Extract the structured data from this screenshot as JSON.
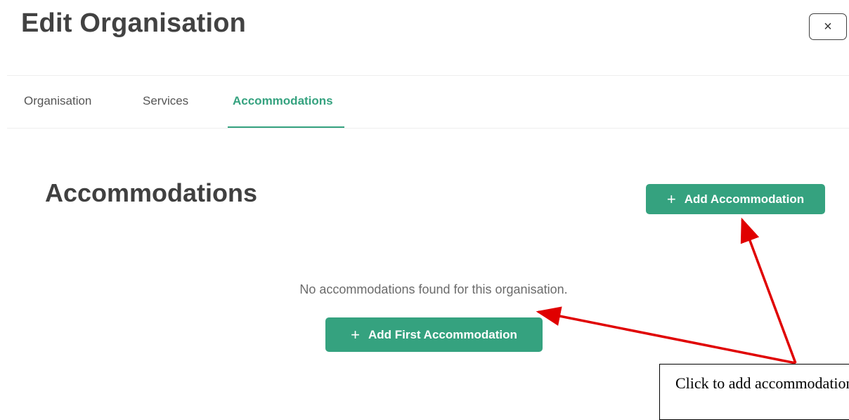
{
  "header": {
    "title": "Edit Organisation",
    "close_label": "×"
  },
  "tabs": [
    {
      "label": "Organisation",
      "active": false
    },
    {
      "label": "Services",
      "active": false
    },
    {
      "label": "Accommodations",
      "active": true
    }
  ],
  "section": {
    "title": "Accommodations",
    "add_button_label": "Add Accommodation",
    "plus_glyph": "+"
  },
  "empty_state": {
    "message": "No accommodations found for this organisation.",
    "button_label": "Add First Accommodation"
  },
  "annotation": {
    "text": "Click to add accommodation"
  },
  "colors": {
    "accent": "#35a27f",
    "annotation_arrow": "#e00000"
  }
}
